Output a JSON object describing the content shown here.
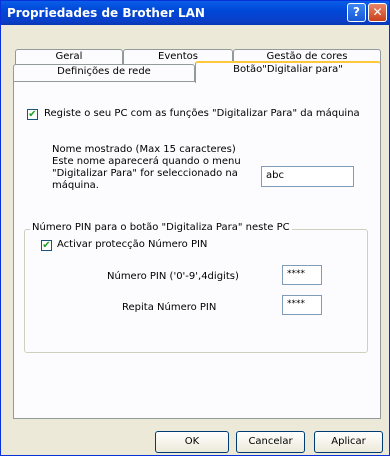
{
  "window": {
    "title_left": "Propriedades de Brother",
    "title_right": "LAN",
    "help_glyph": "?",
    "close_glyph": "✕"
  },
  "tabs_row1": [
    {
      "label": "Geral"
    },
    {
      "label": "Eventos"
    },
    {
      "label": "Gestão de cores"
    }
  ],
  "tabs_row2": [
    {
      "label": "Definições de rede"
    },
    {
      "label": "Botão\"Digitaliar para\"",
      "active": true
    }
  ],
  "panel": {
    "register_checked": true,
    "register_label": "Registe o seu PC com as funções \"Digitalizar Para\" da máquina",
    "name_desc": [
      "Nome mostrado (Max 15 caracteres)",
      "Este nome aparecerá quando o menu",
      "\"Digitalizar Para\" for seleccionado na",
      "máquina."
    ],
    "name_value": "abc",
    "pin_group": {
      "title": "Número PIN para o botão \"Digitaliza Para\" neste PC",
      "protect_checked": true,
      "protect_label": "Activar protecção Número PIN",
      "pin_label": "Número PIN ('0'-9',4digits)",
      "pin_value": "****",
      "repeat_label": "Repita Número PIN",
      "repeat_value": "****"
    }
  },
  "buttons": {
    "ok": "OK",
    "cancel": "Cancelar",
    "apply": "Aplicar"
  }
}
